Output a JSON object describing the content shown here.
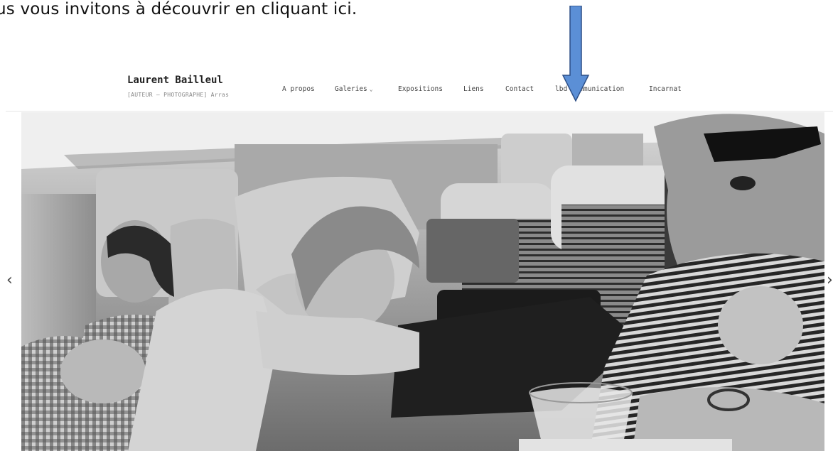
{
  "intro": {
    "text": "us vous invitons à découvrir en cliquant ici."
  },
  "header": {
    "site_title": "Laurent Bailleul",
    "tagline": "[AUTEUR – PHOTOGRAPHE] Arras"
  },
  "nav": {
    "items": [
      {
        "label": "A propos"
      },
      {
        "label": "Galeries",
        "has_dropdown": true
      },
      {
        "label": "Expositions"
      },
      {
        "label": "Liens"
      },
      {
        "label": "Contact"
      },
      {
        "label": "lbd communication"
      },
      {
        "label": "Incarnat"
      }
    ]
  },
  "gallery": {
    "prev_label": "‹",
    "next_label": "›",
    "image": "black-and-white photograph of train passengers"
  },
  "annotation": {
    "arrow_color": "#5b8fd6",
    "arrow_outline": "#2d4f86"
  }
}
